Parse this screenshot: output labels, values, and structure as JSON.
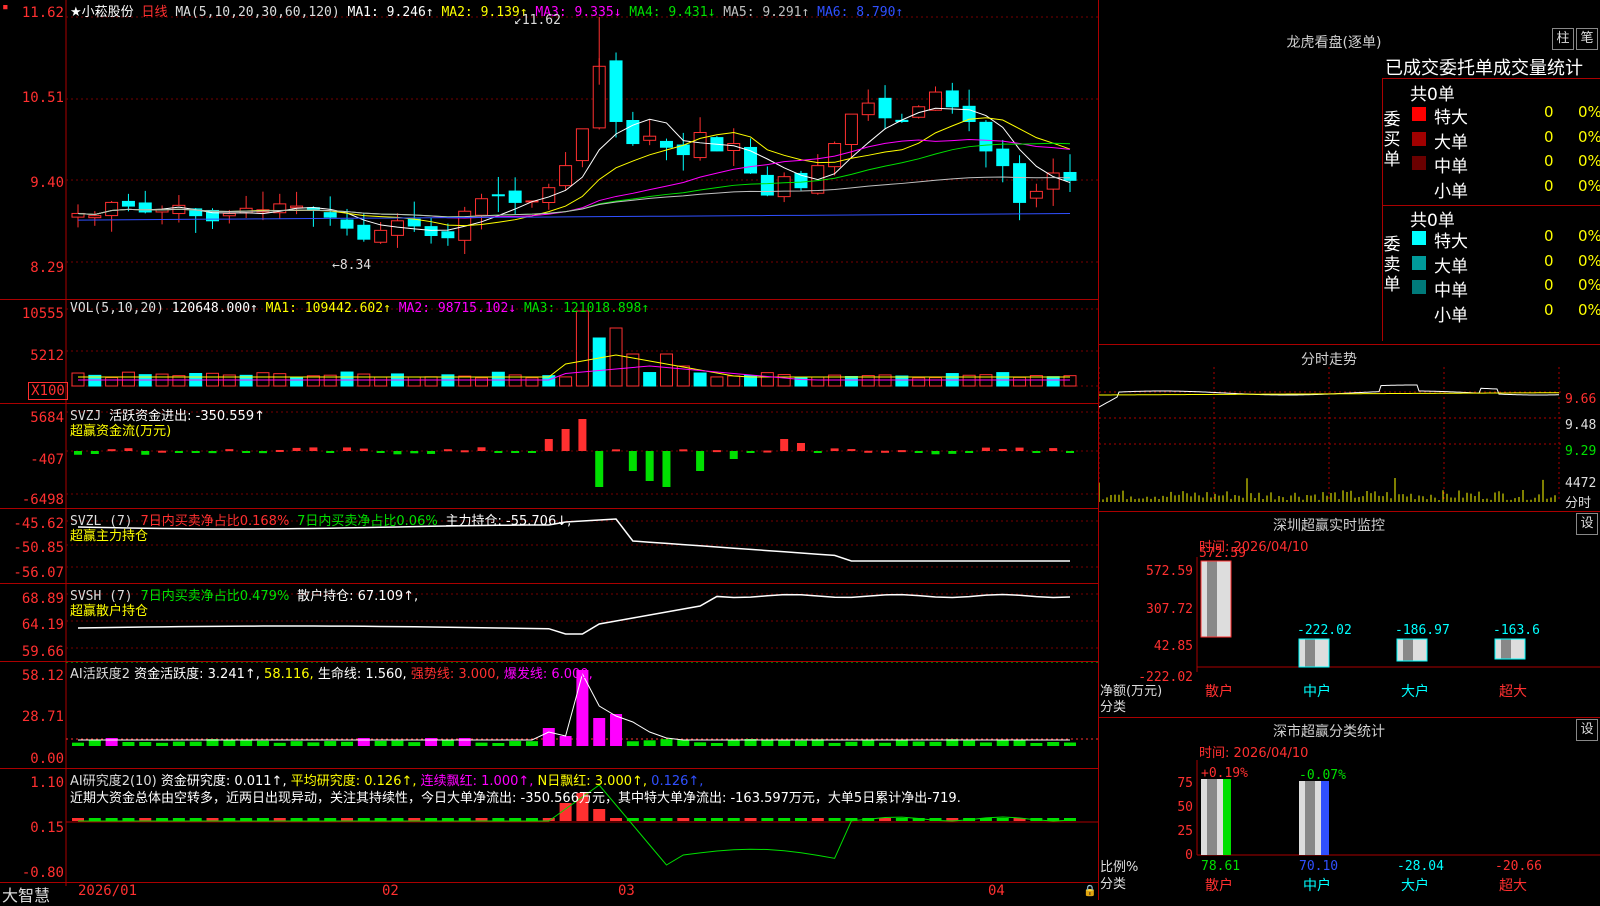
{
  "header": {
    "star_stock": "★小菘股份",
    "period": "日线",
    "ma_params": "MA(5,10,20,30,60,120)",
    "ma1": "MA1: 9.246↑",
    "ma2": "MA2: 9.139↑",
    "ma3": "MA3: 9.335↓",
    "ma4": "MA4: 9.431↓",
    "ma5": "MA5: 9.291↑",
    "ma6": "MA6: 8.790↑",
    "high_mark": "11.62",
    "low_mark": "8.34",
    "ticks": [
      "11.62",
      "10.51",
      "9.40",
      "8.29"
    ]
  },
  "vol": {
    "label": "VOL(5,10,20)",
    "value": "120648.000↑",
    "ma1": "MA1: 109442.602↑",
    "ma2": "MA2: 98715.102↓",
    "ma3": "MA3: 121018.898↑",
    "ticks": [
      "10555",
      "5212",
      "X100"
    ]
  },
  "svzj": {
    "label": "SVZJ",
    "value": "活跃资金进出: -350.559↑",
    "sub": "超赢资金流(万元)",
    "ticks": [
      "5684",
      "-407",
      "-6498"
    ]
  },
  "svzl": {
    "label": "SVZL (7)",
    "a": "7日内买卖净占比0.168%",
    "b": "7日内买卖净占比0.06%",
    "c": "主力持仓: -55.706↓,",
    "sub": "超赢主力持仓",
    "ticks": [
      "-45.62",
      "-50.85",
      "-56.07"
    ]
  },
  "svsh": {
    "label": "SVSH (7)",
    "a": "7日内买卖净占比0.479%",
    "b": "散户持仓: 67.109↑,",
    "sub": "超赢散户持仓",
    "ticks": [
      "68.89",
      "64.19",
      "59.66"
    ]
  },
  "ai1": {
    "label": "AI活跃度2",
    "a": "资金活跃度: 3.241↑,",
    "b": "58.116,",
    "c": "生命线: 1.560,",
    "d": "强势线: 3.000,",
    "e": "爆发线: 6.000,",
    "ticks": [
      "58.12",
      "28.71",
      "0.00"
    ]
  },
  "ai2": {
    "label": "AI研究度2(10)",
    "a": "资金研究度: 0.011↑,",
    "b": "平均研究度: 0.126↑,",
    "c": "连续飘红: 1.000↑,",
    "d": "N日飘红: 3.000↑,",
    "e": "0.126↑,",
    "desc": "近期大资金总体由空转多，近两日出现异动，关注其持续性，今日大单净流出: -350.566万元，其中特大单净流出: -163.597万元，大单5日累计净出-719.",
    "ticks": [
      "1.10",
      "0.15",
      "-0.80"
    ]
  },
  "xaxis": {
    "labels": [
      "2026/01",
      "02",
      "03",
      "04"
    ],
    "brand": "大智慧"
  },
  "dragon": {
    "title": "龙虎看盘(逐单)",
    "btn_a": "柱",
    "btn_b": "笔",
    "subtitle": "已成交委托单成交量统计",
    "buy_label": "委买单",
    "sell_label": "委卖单",
    "buy_total": "共0单",
    "sell_total": "共0单",
    "rows_buy": [
      {
        "name": "特大",
        "n": "0",
        "p": "0%",
        "color": "#ff0000"
      },
      {
        "name": "大单",
        "n": "0",
        "p": "0%",
        "color": "#a00000"
      },
      {
        "name": "中单",
        "n": "0",
        "p": "0%",
        "color": "#6a0000"
      },
      {
        "name": "小单",
        "n": "0",
        "p": "0%",
        "color": ""
      }
    ],
    "rows_sell": [
      {
        "name": "特大",
        "n": "0",
        "p": "0%",
        "color": "#00ffff"
      },
      {
        "name": "大单",
        "n": "0",
        "p": "0%",
        "color": "#009a9a"
      },
      {
        "name": "中单",
        "n": "0",
        "p": "0%",
        "color": "#007a7a"
      },
      {
        "name": "小单",
        "n": "0",
        "p": "0%",
        "color": ""
      }
    ]
  },
  "intraday": {
    "title": "分时走势",
    "ticks": [
      "9.66",
      "9.48",
      "9.29"
    ],
    "vol_top": "4472",
    "vol_label": "分时"
  },
  "sz_monitor": {
    "title": "深圳超赢实时监控",
    "btn": "设",
    "time": "时间: 2026/04/10",
    "ylab": "净额(万元)",
    "xlab": "分类",
    "ticks": [
      "572.59",
      "307.72",
      "42.85",
      "-222.02"
    ],
    "chart_data": {
      "type": "bar",
      "categories": [
        "散户",
        "中户",
        "大户",
        "超大"
      ],
      "values": [
        572.59,
        -222.02,
        -186.97,
        -163.6
      ],
      "value_labels": [
        "572.59",
        "-222.02",
        "-186.97",
        "-163.6"
      ],
      "ylim": [
        -222.02,
        572.59
      ]
    }
  },
  "sz_class": {
    "title": "深市超赢分类统计",
    "btn": "设",
    "time": "时间: 2026/04/10",
    "ylab": "比例%",
    "xlab": "分类",
    "ticks": [
      "75",
      "50",
      "25",
      "0"
    ],
    "chart_data": {
      "type": "bar",
      "categories": [
        "散户",
        "中户",
        "大户",
        "超大"
      ],
      "values": [
        78.61,
        70.1,
        -28.04,
        -20.66
      ],
      "top_labels": [
        "+0.19%",
        "-0.07%",
        "",
        ""
      ],
      "value_labels": [
        "78.61",
        "70.10",
        "-28.04",
        "-20.66"
      ],
      "ylim": [
        0,
        75
      ]
    }
  },
  "colors": {
    "up": "#ff3030",
    "down": "#00ffff",
    "green": "#00e000",
    "yellow": "#ffff00",
    "magenta": "#ff00ff"
  }
}
